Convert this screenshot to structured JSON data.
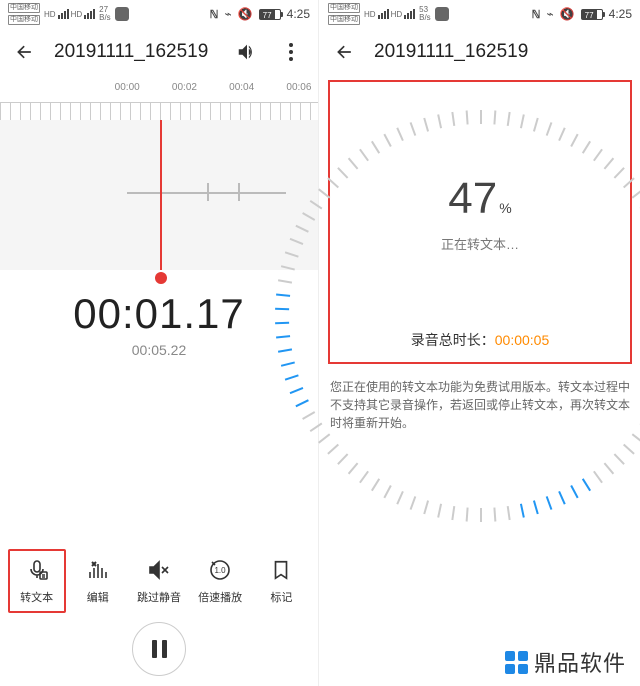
{
  "status": {
    "carrier": "中国移动",
    "speed_left": "27",
    "speed_right": "53",
    "speed_unit": "B/s",
    "battery": "77",
    "time": "4:25"
  },
  "header": {
    "title": "20191111_162519"
  },
  "left": {
    "ticks": [
      "00:00",
      "00:02",
      "00:04",
      "00:06"
    ],
    "current_time": "00:01.17",
    "duration": "00:05.22",
    "tools": [
      {
        "key": "transcribe",
        "label": "转文本"
      },
      {
        "key": "edit",
        "label": "编辑"
      },
      {
        "key": "skip-silence",
        "label": "跳过静音"
      },
      {
        "key": "speed",
        "label": "倍速播放"
      },
      {
        "key": "bookmark",
        "label": "标记"
      }
    ]
  },
  "right": {
    "percent": "47",
    "percent_suffix": "%",
    "progress_text": "正在转文本…",
    "total_prefix": "录音总时长：",
    "total_value": "00:00:05",
    "disclaimer": "您正在使用的转文本功能为免费试用版本。转文本过程中不支持其它录音操作，若返回或停止转文本，再次转文本时将重新开始。"
  },
  "watermark": "鼎品软件"
}
